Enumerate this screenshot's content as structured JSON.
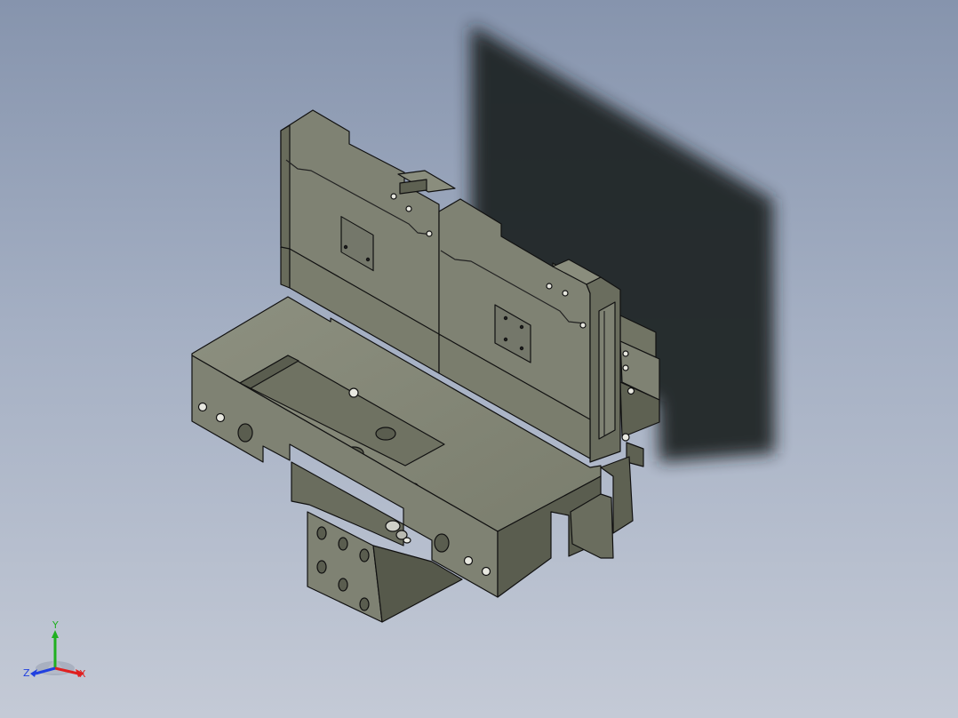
{
  "viewport": {
    "background_top": "#8694ad",
    "background_bottom": "#c4cad6"
  },
  "model": {
    "body_color": "#7f8273",
    "face_light": "#8a8d7d",
    "face_mid": "#717464",
    "face_dark": "#56594b",
    "edge_color": "#111111",
    "shadow_color": "#1f2124"
  },
  "triad": {
    "x_label": "X",
    "y_label": "Y",
    "z_label": "Z",
    "x_color": "#e02020",
    "y_color": "#20b020",
    "z_color": "#2040e0"
  }
}
